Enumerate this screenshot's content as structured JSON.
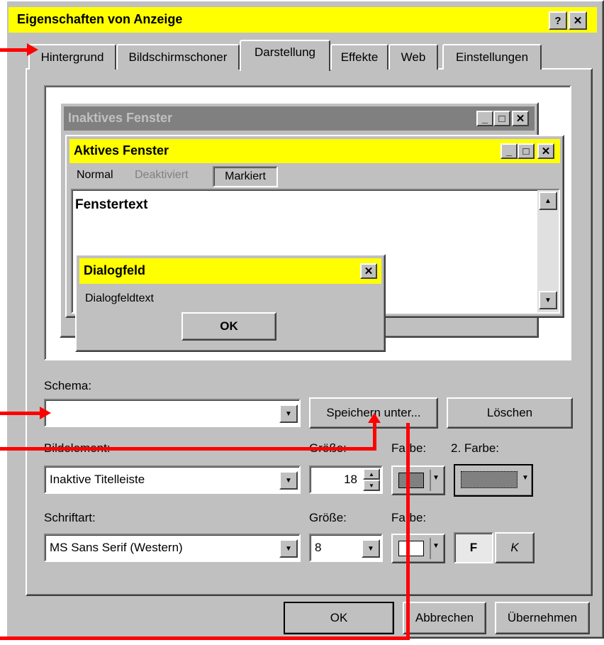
{
  "window": {
    "title": "Eigenschaften von Anzeige",
    "help_button": "?",
    "close_button": "✕"
  },
  "tabs": [
    {
      "label": "Hintergrund"
    },
    {
      "label": "Bildschirmschoner"
    },
    {
      "label": "Darstellung"
    },
    {
      "label": "Effekte"
    },
    {
      "label": "Web"
    },
    {
      "label": "Einstellungen"
    }
  ],
  "active_tab": "Darstellung",
  "preview": {
    "inactive_title": "Inaktives Fenster",
    "active_title": "Aktives Fenster",
    "menu_normal": "Normal",
    "menu_disabled": "Deaktiviert",
    "menu_selected": "Markiert",
    "window_text": "Fenstertext",
    "dialog_title": "Dialogfeld",
    "dialog_text": "Dialogfeldtext",
    "dialog_ok": "OK",
    "min_glyph": "_",
    "max_glyph": "□",
    "close_glyph": "✕"
  },
  "schema": {
    "label": "Schema:",
    "value": "",
    "save_as": "Speichern unter...",
    "delete": "Löschen"
  },
  "element": {
    "label": "Bildelement:",
    "value": "Inaktive Titelleiste",
    "size_label": "Größe:",
    "size_value": "18",
    "color_label": "Farbe:",
    "color2_label": "2. Farbe:"
  },
  "font": {
    "label": "Schriftart:",
    "value": "MS Sans Serif (Western)",
    "size_label": "Größe:",
    "size_value": "8",
    "color_label": "Farbe:",
    "bold": "F",
    "italic": "K"
  },
  "footer": {
    "ok": "OK",
    "cancel": "Abbrechen",
    "apply": "Übernehmen"
  },
  "colors": {
    "title_highlight": "#ffff00",
    "face": "#c0c0c0",
    "inactive_title": "#808080",
    "annotation": "#ff0000"
  }
}
